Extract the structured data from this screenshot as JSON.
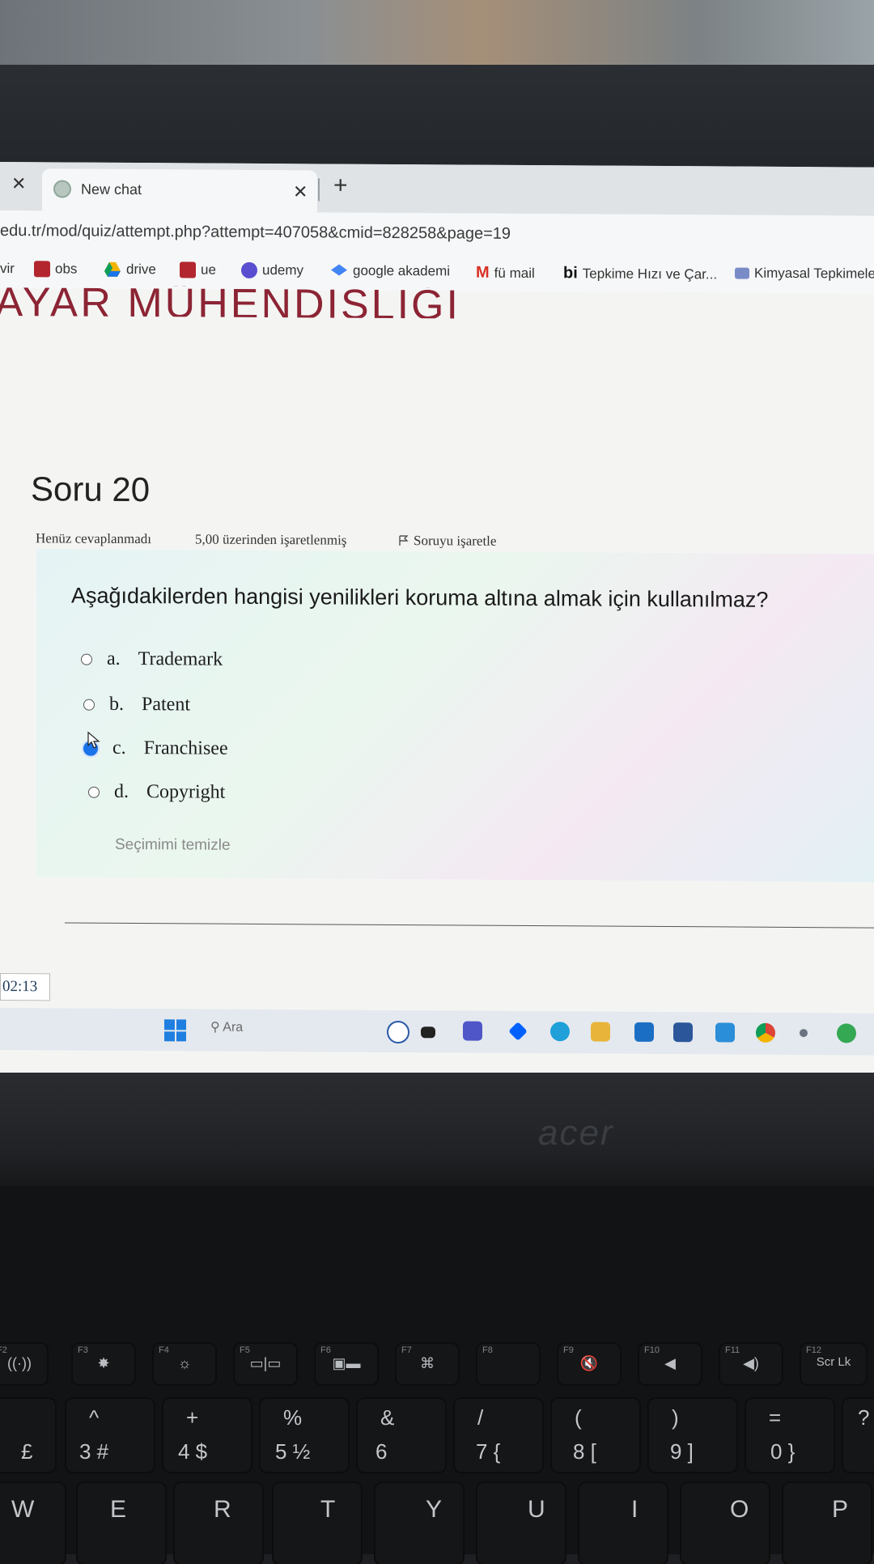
{
  "browser": {
    "tab_title": "New chat",
    "new_tab_label": "+",
    "url": "edu.tr/mod/quiz/attempt.php?attempt=407058&cmid=828258&page=19",
    "bookmarks": [
      {
        "label": "vir",
        "icon": "bookmark-fragment"
      },
      {
        "label": "obs",
        "icon": "grid-logo-icon",
        "color": "#b3262e"
      },
      {
        "label": "drive",
        "icon": "drive-icon",
        "color": "#f4b400"
      },
      {
        "label": "ue",
        "icon": "grid-logo-icon",
        "color": "#b3262e"
      },
      {
        "label": "udemy",
        "icon": "udemy-icon",
        "color": "#5a4fd1"
      },
      {
        "label": "google akademi",
        "icon": "scholar-icon",
        "color": "#4285f4"
      },
      {
        "label": "fü mail",
        "icon": "gmail-icon",
        "color": "#d93025"
      },
      {
        "label": "Tepkime Hızı ve Çar...",
        "icon": "bi-icon",
        "color": "#111111"
      },
      {
        "label": "Kimyasal Tepkimele",
        "icon": "site-icon",
        "color": "#7a8cc8"
      }
    ]
  },
  "page": {
    "header": "AYAR MÜHENDİSLİĞİ",
    "question_number": "Soru 20",
    "status": "Henüz cevaplanmadı",
    "marks": "5,00 üzerinden işaretlenmiş",
    "flag_label": "Soruyu işaretle",
    "question": "Aşağıdakilerden hangisi yenilikleri koruma altına almak için kullanılmaz?",
    "options": [
      {
        "letter": "a.",
        "text": "Trademark",
        "selected": false
      },
      {
        "letter": "b.",
        "text": "Patent",
        "selected": false
      },
      {
        "letter": "c.",
        "text": "Franchisee",
        "selected": true
      },
      {
        "letter": "d.",
        "text": "Copyright",
        "selected": false
      }
    ],
    "clear_choice": "Seçimimi temizle",
    "timer": "02:13"
  },
  "taskbar": {
    "search_placeholder": "Ara",
    "apps": [
      "dell-icon",
      "files-icon",
      "meet-icon",
      "dropbox-icon",
      "edge-icon",
      "explorer-icon",
      "mail-icon",
      "word-icon",
      "vscode-icon",
      "chrome-icon",
      "app-icon",
      "infinity-icon"
    ]
  },
  "laptop": {
    "brand": "acer",
    "fn_keys": [
      {
        "label": "F2",
        "icon": "((·))"
      },
      {
        "label": "F3",
        "icon": "✸"
      },
      {
        "label": "F4",
        "icon": "☼"
      },
      {
        "label": "F5",
        "icon": "▭|▭"
      },
      {
        "label": "F6",
        "icon": "▣▬"
      },
      {
        "label": "F7",
        "icon": "⌘"
      },
      {
        "label": "F8",
        "icon": ""
      },
      {
        "label": "F9",
        "icon": "🔇"
      },
      {
        "label": "F10",
        "icon": "◀"
      },
      {
        "label": "F11",
        "icon": "◀)"
      },
      {
        "label": "F12",
        "icon": "Scr Lk"
      }
    ],
    "number_row": [
      {
        "top": "",
        "bottom": "£"
      },
      {
        "top": "^",
        "bottom": "3   #"
      },
      {
        "top": "+",
        "bottom": "4   $"
      },
      {
        "top": "%",
        "bottom": "5   ½"
      },
      {
        "top": "&",
        "bottom": "6"
      },
      {
        "top": "/",
        "bottom": "7   {"
      },
      {
        "top": "(",
        "bottom": "8   ["
      },
      {
        "top": ")",
        "bottom": "9   ]"
      },
      {
        "top": "=",
        "bottom": "0   }"
      },
      {
        "top": "?",
        "bottom": ""
      }
    ],
    "letter_row": [
      "W",
      "E",
      "R",
      "T",
      "Y",
      "U",
      "I",
      "O",
      "P"
    ]
  }
}
